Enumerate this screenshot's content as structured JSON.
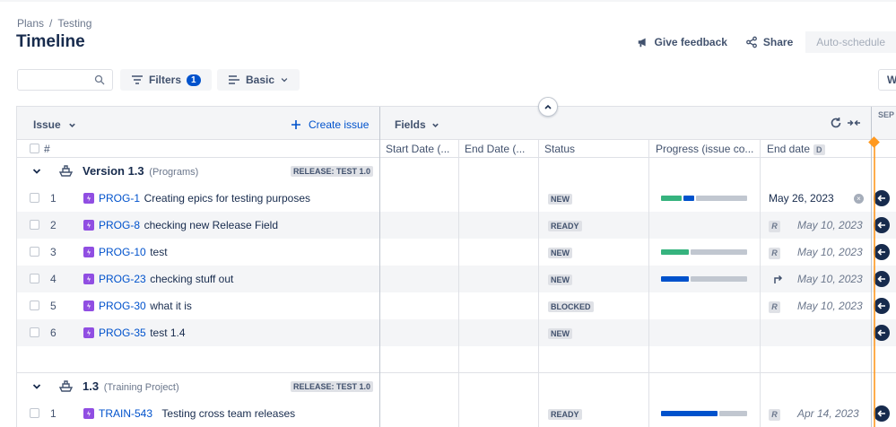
{
  "breadcrumb": {
    "plans": "Plans",
    "separator": "/",
    "current": "Testing"
  },
  "title": "Timeline",
  "header_actions": {
    "feedback": "Give feedback",
    "share": "Share",
    "auto_schedule": "Auto-schedule"
  },
  "toolbar": {
    "search_placeholder": "",
    "filters_label": "Filters",
    "filters_count": "1",
    "view_label": "Basic",
    "right_partial": "W"
  },
  "grid_header": {
    "issue": "Issue",
    "create_issue": "Create issue",
    "fields": "Fields",
    "timeline_month": "SEP"
  },
  "columns": {
    "number": "#",
    "start_date": "Start Date (...",
    "end_date": "End Date (...",
    "status": "Status",
    "progress": "Progress (issue co...",
    "end_date2": "End date",
    "end_date2_badge": "D"
  },
  "groups": [
    {
      "title": "Version 1.3",
      "subtitle": "(Programs)",
      "release": "RELEASE: TEST 1.0",
      "rows": [
        {
          "num": "1",
          "key": "PROG-1",
          "summary": "Creating epics for testing purposes",
          "status": "NEW",
          "progress": [
            0.25,
            0.14,
            0.61
          ],
          "end_date": "May 26, 2023",
          "date_style": "normal",
          "marker": "clear"
        },
        {
          "num": "2",
          "key": "PROG-8",
          "summary": "checking new Release Field",
          "status": "READY",
          "progress": null,
          "end_date": "May 10, 2023",
          "date_style": "rollup",
          "marker": "R"
        },
        {
          "num": "3",
          "key": "PROG-10",
          "summary": "test",
          "status": "NEW",
          "progress": [
            0.33,
            0,
            0.67
          ],
          "end_date": "May 10, 2023",
          "date_style": "rollup",
          "marker": "R"
        },
        {
          "num": "4",
          "key": "PROG-23",
          "summary": "checking stuff out",
          "status": "NEW",
          "progress": [
            0,
            0.33,
            0.67
          ],
          "end_date": "May 10, 2023",
          "date_style": "rollup",
          "marker": "arrow"
        },
        {
          "num": "5",
          "key": "PROG-30",
          "summary": "what it is",
          "status": "BLOCKED",
          "progress": null,
          "end_date": "May 10, 2023",
          "date_style": "rollup",
          "marker": "R"
        },
        {
          "num": "6",
          "key": "PROG-35",
          "summary": "test 1.4",
          "status": "NEW",
          "progress": null,
          "end_date": "",
          "date_style": "none",
          "marker": ""
        }
      ]
    },
    {
      "title": "1.3",
      "subtitle": "(Training Project)",
      "release": "RELEASE: TEST 1.0",
      "rows": [
        {
          "num": "1",
          "key": "TRAIN-543",
          "summary": "Testing cross team releases",
          "status": "READY",
          "progress": [
            0,
            0.67,
            0.33
          ],
          "end_date": "Apr 14, 2023",
          "date_style": "rollup",
          "marker": "R"
        }
      ]
    }
  ],
  "colors": {
    "accent": "#0052cc",
    "progress_done": "#36b37e",
    "progress_inprogress": "#0052cc",
    "progress_todo": "#c1c7d0",
    "today_line": "#ff991f",
    "story_icon": "#904ee2"
  }
}
